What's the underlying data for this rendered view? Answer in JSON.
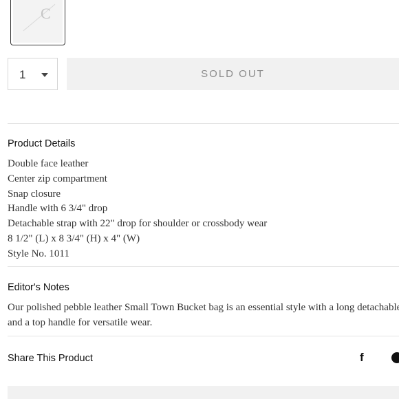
{
  "swatch": {
    "logo_letter": "C"
  },
  "purchase": {
    "quantity": "1",
    "sold_out_label": "SOLD OUT"
  },
  "product_details": {
    "heading": "Product Details",
    "items": [
      "Double face leather",
      "Center zip compartment",
      "Snap closure",
      "Handle with 6 3/4\" drop",
      "Detachable strap with 22\" drop for shoulder or crossbody wear",
      "8 1/2\" (L) x 8 3/4\" (H) x 4\" (W)",
      "Style No. 1011"
    ]
  },
  "editors_notes": {
    "heading": "Editor's Notes",
    "line1": "Our polished pebble leather Small Town Bucket bag is an essential style with a long detachable strap",
    "line2": "and a top handle for versatile wear."
  },
  "share": {
    "heading": "Share This Product",
    "facebook_glyph": "f"
  },
  "colors": {
    "sold_out_bg": "#f1f1f1",
    "sold_out_text": "#8c8c8c",
    "divider": "#e4e4e4"
  },
  "icons": [
    "caret-down-icon",
    "facebook-icon",
    "pinterest-icon"
  ]
}
